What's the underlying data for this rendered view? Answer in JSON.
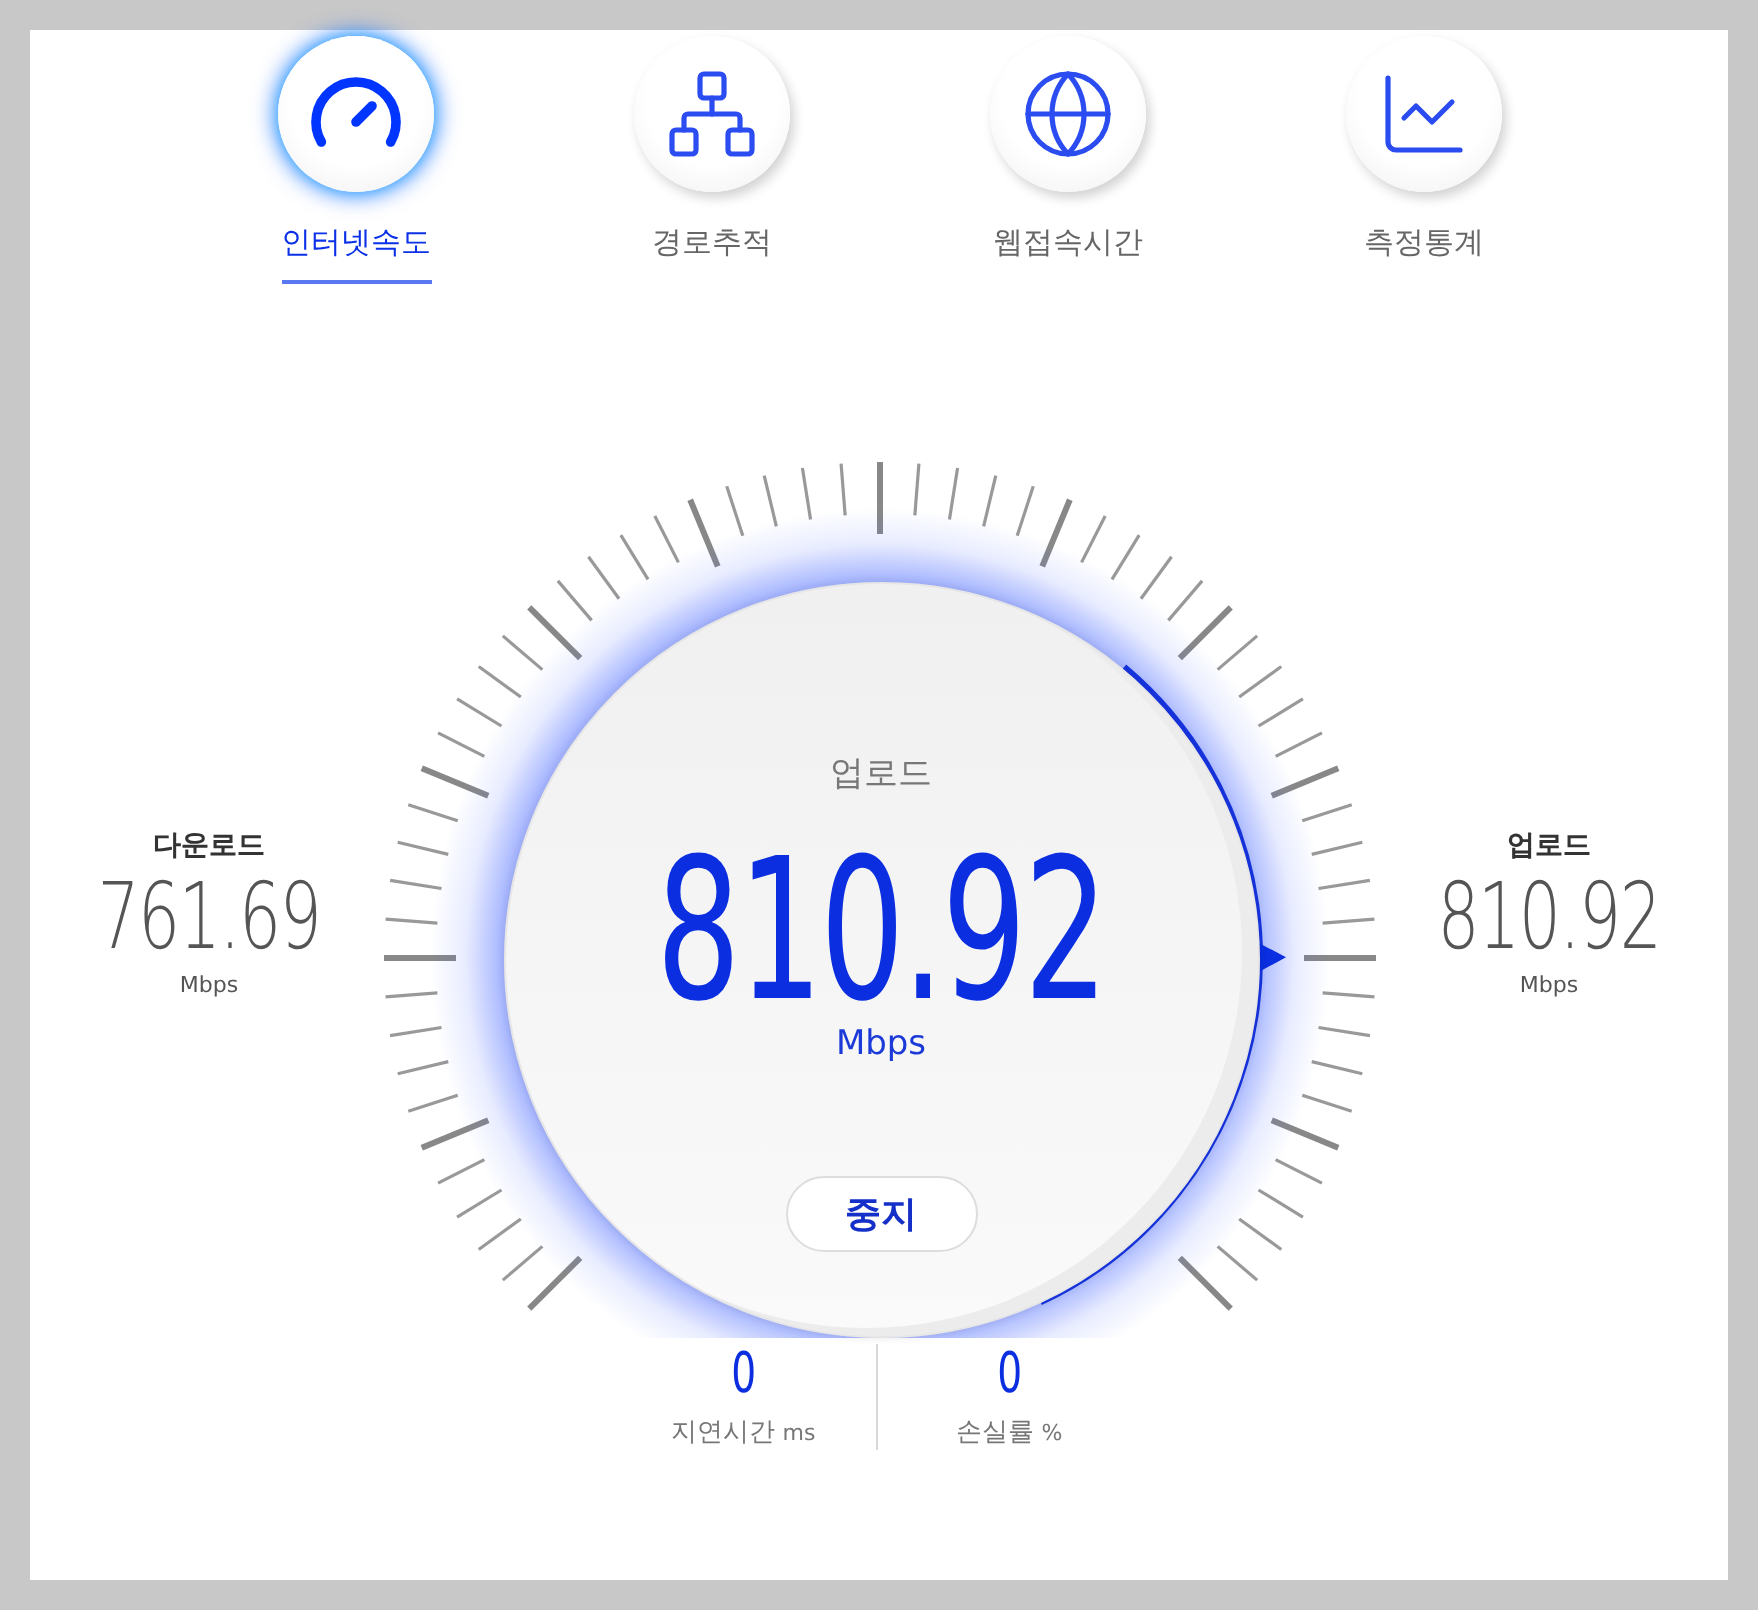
{
  "tabs": [
    {
      "label": "인터넷속도",
      "kind": "gauge",
      "selected": true
    },
    {
      "label": "경로추적",
      "kind": "route",
      "selected": false
    },
    {
      "label": "웹접속시간",
      "kind": "globe",
      "selected": false
    },
    {
      "label": "측정통계",
      "kind": "stats",
      "selected": false
    }
  ],
  "gauge": {
    "title": "업로드",
    "value": "810.92",
    "unit": "Mbps",
    "stop_button": "중지"
  },
  "readings": [
    {
      "label": "다운로드",
      "value": "761.69",
      "unit": "Mbps"
    },
    {
      "label": "업로드",
      "value": "810.92",
      "unit": "Mbps"
    }
  ],
  "stats": [
    {
      "value": "0",
      "label": "지연시간",
      "unit": "ms"
    },
    {
      "value": "0",
      "label": "손실률",
      "unit": "%"
    }
  ]
}
